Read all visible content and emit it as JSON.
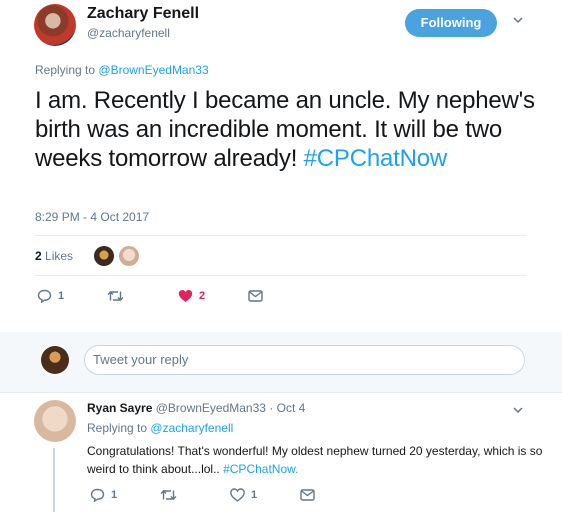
{
  "tweet": {
    "author_name": "Zachary Fenell",
    "author_handle": "@zacharyfenell",
    "follow_label": "Following",
    "replying_prefix": "Replying to",
    "replying_to": "@BrownEyedMan33",
    "text": "I am. Recently I became an uncle. My nephew's birth was an incredible moment. It will be two weeks tomorrow already!",
    "hashtag": "#CPChatNow",
    "timestamp": "8:29 PM - 4 Oct 2017",
    "likes_count": "2",
    "likes_label": "Likes",
    "actions": {
      "reply_count": "1",
      "retweet_count": "",
      "like_count": "2"
    }
  },
  "reply_box": {
    "placeholder": "Tweet your reply"
  },
  "reply": {
    "author_name": "Ryan Sayre",
    "author_handle": "@BrownEyedMan33",
    "separator": "·",
    "date": "Oct 4",
    "replying_prefix": "Replying to",
    "replying_to": "@zacharyfenell",
    "text": "Congratulations! That's wonderful! My oldest nephew turned 20 yesterday, which is so weird to think about...lol..",
    "hashtag": "#CPChatNow.",
    "actions": {
      "reply_count": "1",
      "retweet_count": "",
      "like_count": "1"
    }
  },
  "colors": {
    "accent": "#1da1f2",
    "follow_button": "#4aa3df",
    "like_active": "#e0245e",
    "muted": "#657786"
  },
  "icons": [
    "reply-icon",
    "retweet-icon",
    "heart-icon",
    "direct-message-icon",
    "chevron-down-icon"
  ]
}
